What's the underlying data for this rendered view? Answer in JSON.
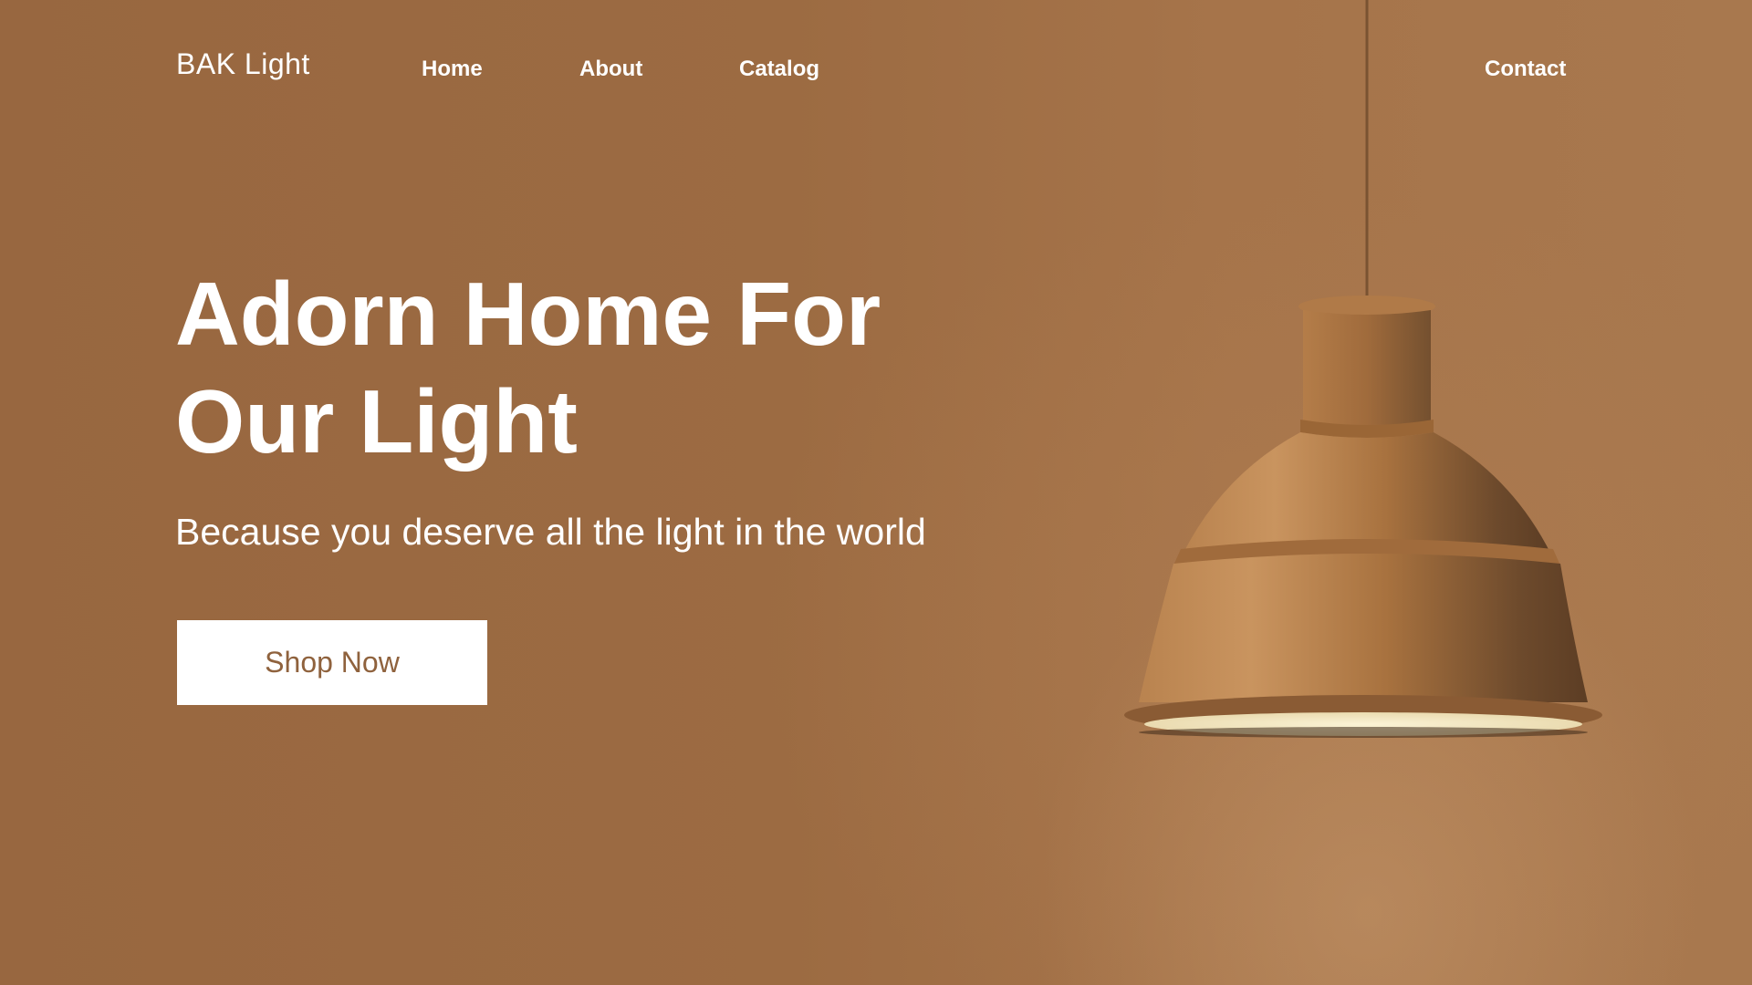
{
  "brand": {
    "name": "BAK Light"
  },
  "nav": {
    "home": "Home",
    "about": "About",
    "catalog": "Catalog",
    "contact": "Contact"
  },
  "hero": {
    "title_line1": "Adorn Home For",
    "title_line2": "Our Light",
    "subtitle": "Because you deserve all the light in the world",
    "cta_label": "Shop Now"
  },
  "image": {
    "subject": "pendant-lamp"
  },
  "colors": {
    "background": "#9a6a3f",
    "text": "#ffffff",
    "cta_background": "#ffffff",
    "cta_text": "#8f623d",
    "lamp_shade": "#b07a48",
    "lamp_glow": "#f3e7c3"
  }
}
